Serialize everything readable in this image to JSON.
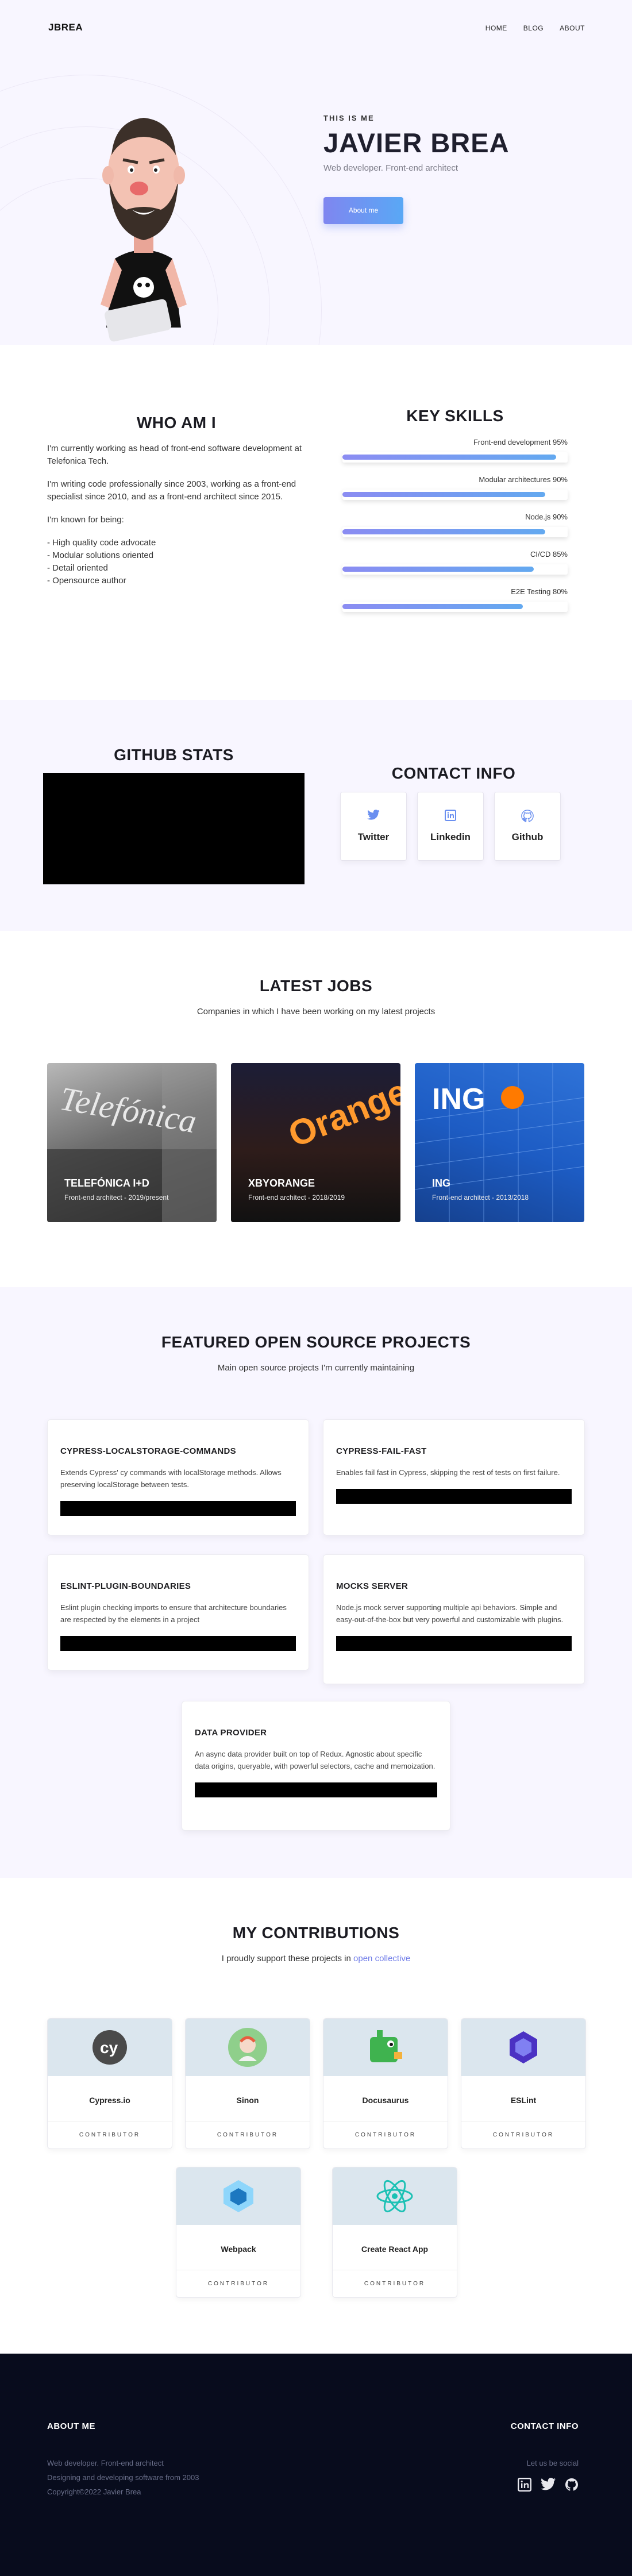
{
  "header": {
    "logo": "JBREA",
    "nav": [
      "HOME",
      "BLOG",
      "ABOUT"
    ]
  },
  "hero": {
    "eyebrow": "THIS IS ME",
    "name": "JAVIER BREA",
    "subtitle": "Web developer. Front-end architect",
    "button": "About me"
  },
  "who": {
    "title": "WHO AM I",
    "paragraphs": [
      "I'm currently working as head of front-end software development at Telefonica Tech.",
      "I'm writing code professionally since 2003, working as a front-end specialist since 2010, and as a front-end architect since 2015.",
      "I'm known for being:"
    ],
    "traits": [
      "- High quality code advocate",
      "- Modular solutions oriented",
      "- Detail oriented",
      "- Opensource author"
    ]
  },
  "skills": {
    "title": "KEY SKILLS",
    "items": [
      {
        "label": "Front-end development 95%",
        "value": 95
      },
      {
        "label": "Modular architectures 90%",
        "value": 90
      },
      {
        "label": "Node.js 90%",
        "value": 90
      },
      {
        "label": "CI/CD 85%",
        "value": 85
      },
      {
        "label": "E2E Testing 80%",
        "value": 80
      }
    ],
    "accent_from": "#8b8cf2",
    "accent_to": "#63a9f0"
  },
  "github": {
    "title": "GITHUB STATS"
  },
  "contact": {
    "title": "CONTACT INFO",
    "cards": [
      {
        "label": "Twitter",
        "icon": "twitter-icon"
      },
      {
        "label": "Linkedin",
        "icon": "linkedin-icon"
      },
      {
        "label": "Github",
        "icon": "github-icon"
      }
    ]
  },
  "jobs": {
    "title": "LATEST JOBS",
    "subtitle": "Companies in which I have been working on my latest projects",
    "items": [
      {
        "name": "TELEFÓNICA I+D",
        "meta": "Front-end architect - 2019/present",
        "sign": "Telefónica"
      },
      {
        "name": "XBYORANGE",
        "meta": "Front-end architect - 2018/2019",
        "sign": "Orange"
      },
      {
        "name": "ING",
        "meta": "Front-end architect - 2013/2018",
        "sign": "ING"
      }
    ]
  },
  "projects": {
    "title": "FEATURED OPEN SOURCE PROJECTS",
    "subtitle": "Main open source projects I'm currently maintaining",
    "items": [
      {
        "name": "CYPRESS-LOCALSTORAGE-COMMANDS",
        "desc": "Extends Cypress' cy commands with localStorage methods. Allows preserving localStorage between tests."
      },
      {
        "name": "CYPRESS-FAIL-FAST",
        "desc": "Enables fail fast in Cypress, skipping the rest of tests on first failure."
      },
      {
        "name": "ESLINT-PLUGIN-BOUNDARIES",
        "desc": "Eslint plugin checking imports to ensure that architecture boundaries are respected by the elements in a project"
      },
      {
        "name": "MOCKS SERVER",
        "desc": "Node.js mock server supporting multiple api behaviors. Simple and easy-out-of-the-box but very powerful and customizable with plugins."
      },
      {
        "name": "DATA PROVIDER",
        "desc": "An async data provider built on top of Redux. Agnostic about specific data origins, queryable, with powerful selectors, cache and memoization."
      }
    ]
  },
  "contrib": {
    "title": "MY CONTRIBUTIONS",
    "subtitle": "I proudly support these projects in",
    "link": "open collective",
    "role": "CONTRIBUTOR",
    "items": [
      {
        "name": "Cypress.io",
        "icon": "cypress-icon"
      },
      {
        "name": "Sinon",
        "icon": "sinon-icon"
      },
      {
        "name": "Docusaurus",
        "icon": "docusaurus-icon"
      },
      {
        "name": "ESLint",
        "icon": "eslint-icon"
      },
      {
        "name": "Webpack",
        "icon": "webpack-icon"
      },
      {
        "name": "Create React App",
        "icon": "react-icon"
      }
    ]
  },
  "footer": {
    "about_title": "ABOUT ME",
    "about_lines": [
      "Web developer. Front-end architect",
      "Designing and developing software from 2003",
      "Copyright©2022 Javier Brea"
    ],
    "contact_title": "CONTACT INFO",
    "contact_sub": "Let us be social"
  }
}
